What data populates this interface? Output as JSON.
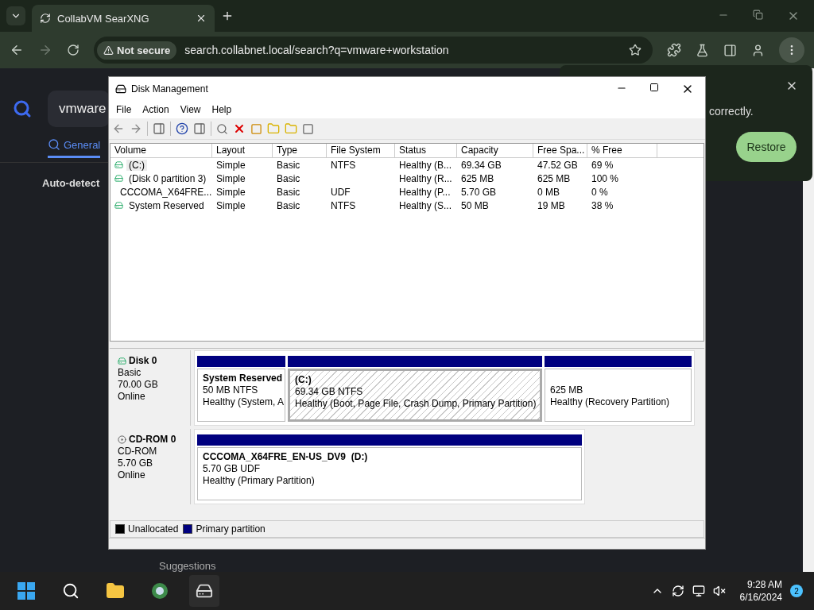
{
  "browser": {
    "tab_title": "CollabVM SearXNG",
    "not_secure": "Not secure",
    "url": "search.collabnet.local/search?q=vmware+workstation"
  },
  "page": {
    "query": "vmware",
    "tabs": [
      {
        "label": "General",
        "selected": true
      }
    ],
    "auto_detect": "Auto-detect",
    "suggestions": "Suggestions"
  },
  "popup": {
    "text": "correctly.",
    "button": "Restore"
  },
  "window": {
    "title": "Disk Management",
    "menu": [
      "File",
      "Action",
      "View",
      "Help"
    ],
    "columns": [
      "Volume",
      "Layout",
      "Type",
      "File System",
      "Status",
      "Capacity",
      "Free Spa...",
      "% Free"
    ],
    "rows": [
      {
        "kind": "disk",
        "selected": true,
        "cells": [
          "(C:)",
          "Simple",
          "Basic",
          "NTFS",
          "Healthy (B...",
          "69.34 GB",
          "47.52 GB",
          "69 %"
        ]
      },
      {
        "kind": "disk",
        "selected": false,
        "cells": [
          "(Disk 0 partition 3)",
          "Simple",
          "Basic",
          "",
          "Healthy (R...",
          "625 MB",
          "625 MB",
          "100 %"
        ]
      },
      {
        "kind": "cdrom",
        "selected": false,
        "cells": [
          "CCCOMA_X64FRE...",
          "Simple",
          "Basic",
          "UDF",
          "Healthy (P...",
          "5.70 GB",
          "0 MB",
          "0 %"
        ]
      },
      {
        "kind": "disk",
        "selected": false,
        "cells": [
          "System Reserved",
          "Simple",
          "Basic",
          "NTFS",
          "Healthy (S...",
          "50 MB",
          "19 MB",
          "38 %"
        ]
      }
    ],
    "disks": [
      {
        "kind": "disk",
        "name": "Disk 0",
        "type": "Basic",
        "size": "70.00 GB",
        "status": "Online",
        "partitions": [
          {
            "name": "System Reserved",
            "detail": "50 MB NTFS",
            "status": "Healthy (System, A",
            "selected": false
          },
          {
            "name": "(C:)",
            "detail": "69.34 GB NTFS",
            "status": "Healthy (Boot, Page File, Crash Dump, Primary Partition)",
            "selected": true
          },
          {
            "detail": "625 MB",
            "status": "Healthy (Recovery Partition)",
            "selected": false
          }
        ]
      },
      {
        "kind": "cdrom",
        "name": "CD-ROM 0",
        "type": "CD-ROM",
        "size": "5.70 GB",
        "status": "Online",
        "partitions": [
          {
            "name": "CCCOMA_X64FRE_EN-US_DV9  (D:)",
            "detail": "5.70 GB UDF",
            "status": "Healthy (Primary Partition)",
            "selected": false
          }
        ]
      }
    ],
    "legend": [
      {
        "label": "Unallocated",
        "color": "#000000"
      },
      {
        "label": "Primary partition",
        "color": "#00007f"
      }
    ]
  },
  "taskbar": {
    "time": "9:28 AM",
    "date": "6/16/2024",
    "badge": "2"
  }
}
